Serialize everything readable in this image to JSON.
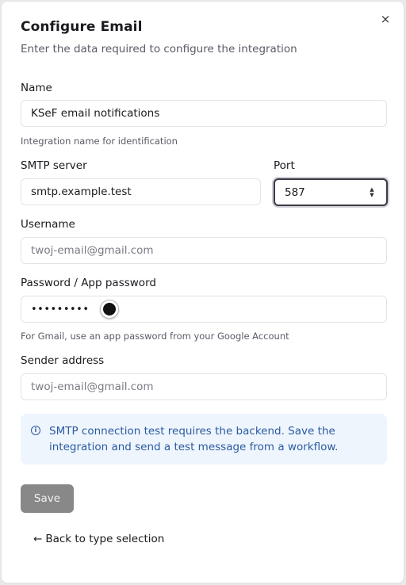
{
  "dialog": {
    "title": "Configure Email",
    "subtitle": "Enter the data required to configure the integration",
    "close_icon": "×"
  },
  "form": {
    "name": {
      "label": "Name",
      "value": "KSeF email notifications",
      "hint": "Integration name for identification"
    },
    "smtp_server": {
      "label": "SMTP server",
      "value": "smtp.example.test"
    },
    "port": {
      "label": "Port",
      "value": "587"
    },
    "username": {
      "label": "Username",
      "placeholder": "twoj-email@gmail.com"
    },
    "password": {
      "label": "Password / App password",
      "value": "•••••••••",
      "hint": "For Gmail, use an app password from your Google Account"
    },
    "sender": {
      "label": "Sender address",
      "placeholder": "twoj-email@gmail.com"
    }
  },
  "info": {
    "icon": "i",
    "text": "SMTP connection test requires the backend. Save the integration and send a test message from a workflow.",
    "color": "#2c5aa0",
    "background": "#eef5fd"
  },
  "actions": {
    "save_label": "Save",
    "back_arrow": "←",
    "back_label": "Back to type selection"
  }
}
